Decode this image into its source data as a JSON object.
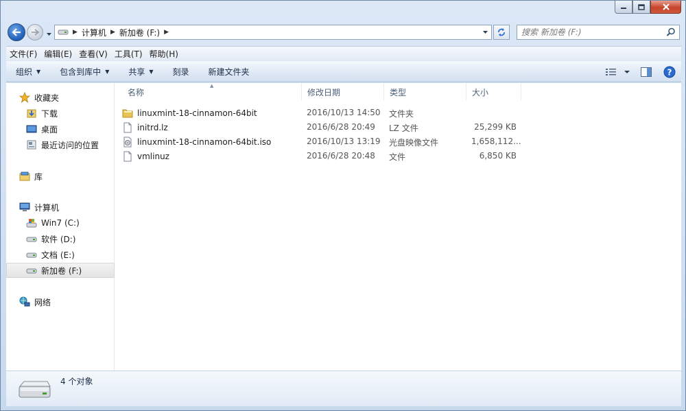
{
  "window": {
    "caption_buttons": [
      "minimize",
      "maximize",
      "close"
    ]
  },
  "address_bar": {
    "crumbs": [
      "计算机",
      "新加卷 (F:)"
    ]
  },
  "search": {
    "placeholder": "搜索 新加卷 (F:)"
  },
  "menu": {
    "items": [
      "文件(F)",
      "编辑(E)",
      "查看(V)",
      "工具(T)",
      "帮助(H)"
    ]
  },
  "commands": {
    "organize": "组织",
    "include_in_library": "包含到库中",
    "share": "共享",
    "burn": "刻录",
    "new_folder": "新建文件夹"
  },
  "sidebar": {
    "favorites": "收藏夹",
    "downloads": "下载",
    "desktop": "桌面",
    "recent": "最近访问的位置",
    "libraries": "库",
    "computer": "计算机",
    "drive_c": "Win7 (C:)",
    "drive_d": "软件 (D:)",
    "drive_e": "文档 (E:)",
    "drive_f": "新加卷 (F:)",
    "network": "网络"
  },
  "columns": {
    "name": "名称",
    "date": "修改日期",
    "type": "类型",
    "size": "大小"
  },
  "files": [
    {
      "name": "linuxmint-18-cinnamon-64bit",
      "date": "2016/10/13 14:50",
      "type": "文件夹",
      "size": "",
      "icon": "folder-icon"
    },
    {
      "name": "initrd.lz",
      "date": "2016/6/28 20:49",
      "type": "LZ 文件",
      "size": "25,299 KB",
      "icon": "file-icon"
    },
    {
      "name": "linuxmint-18-cinnamon-64bit.iso",
      "date": "2016/10/13 13:19",
      "type": "光盘映像文件",
      "size": "1,658,112...",
      "icon": "disc-image-icon"
    },
    {
      "name": "vmlinuz",
      "date": "2016/6/28 20:48",
      "type": "文件",
      "size": "6,850 KB",
      "icon": "file-icon"
    }
  ],
  "status": {
    "count": "4 个对象"
  }
}
